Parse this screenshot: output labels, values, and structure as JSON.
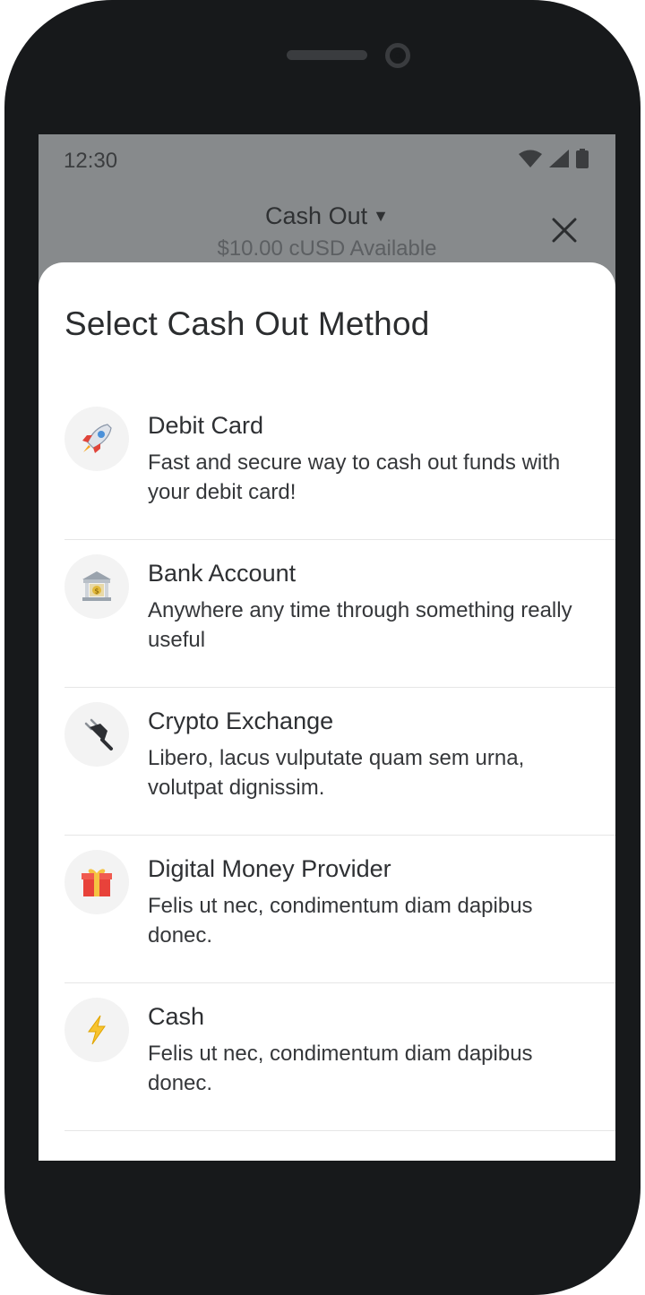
{
  "status_bar": {
    "time": "12:30"
  },
  "header": {
    "title": "Cash Out",
    "balance": "$10.00 cUSD Available"
  },
  "sheet": {
    "title": "Select Cash Out Method",
    "items": [
      {
        "icon": "rocket-icon",
        "title": "Debit Card",
        "description": "Fast and secure way to cash out funds with your debit card!"
      },
      {
        "icon": "bank-icon",
        "title": "Bank Account",
        "description": "Anywhere any time through something really useful"
      },
      {
        "icon": "plug-icon",
        "title": "Crypto Exchange",
        "description": "Libero, lacus vulputate quam sem urna, volutpat dignissim."
      },
      {
        "icon": "gift-icon",
        "title": "Digital Money Provider",
        "description": "Felis ut nec, condimentum diam dapibus donec."
      },
      {
        "icon": "lightning-icon",
        "title": "Cash",
        "description": "Felis ut nec, condimentum diam dapibus donec."
      }
    ]
  },
  "colors": {
    "overlay": "#878a8c",
    "sheet_background": "#ffffff",
    "device_frame": "#17191b",
    "divider": "#e6e6e6",
    "icon_circle": "#f3f3f3"
  }
}
